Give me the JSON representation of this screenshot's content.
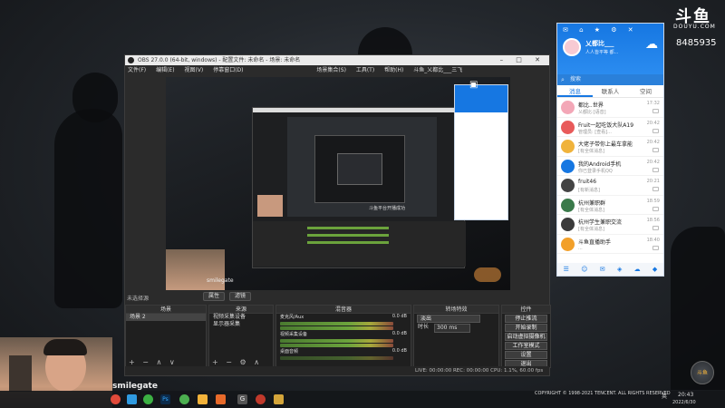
{
  "brand": {
    "logo_text": "斗鱼",
    "logo_sub": "DOUYU.COM",
    "room_id": "8485935"
  },
  "obs": {
    "title": "OBS 27.0.0 (64-bit, windows) - 配置文件: 未命名 - 场景: 未命名",
    "menu": [
      "文件(F)",
      "编辑(E)",
      "视图(V)",
      "停靠窗口(D)",
      "场景集合(S)",
      "工具(T)",
      "帮助(H)",
      "斗鱼_乂都比___三飞"
    ],
    "scene_label": "未选择源",
    "props_btn": "属性",
    "filters_btn": "滤镜",
    "docks": {
      "scenes": {
        "title": "场景",
        "items": [
          "场景 2"
        ]
      },
      "sources": {
        "title": "来源",
        "items": [
          "视频采集设备",
          "显示器采集"
        ]
      },
      "mixer": {
        "title": "混音器",
        "ch1": "麦克风/Aux",
        "ch2": "视频采集设备",
        "ch3": "桌面音频",
        "db1": "0.0 dB",
        "db2": "0.0 dB",
        "db3": "0.0 dB"
      },
      "transitions": {
        "title": "转场特效",
        "type": "淡出",
        "duration_label": "时长",
        "duration": "300 ms"
      },
      "controls": {
        "title": "控件",
        "buttons": [
          "停止推流",
          "开始录制",
          "启动虚拟摄像机",
          "工作室模式",
          "设置",
          "退出"
        ]
      }
    },
    "status": "LIVE: 00:00:00   REC: 00:00:00   CPU: 1.1%, 60.00 fps"
  },
  "preview": {
    "watermark": "smilegate",
    "nested_caption": "斗鱼平台开播成功"
  },
  "qq": {
    "username": "乂都比___",
    "signature": "人人皆平等 都...",
    "search_placeholder": "搜索",
    "tabs": [
      "消息",
      "联系人",
      "空间"
    ],
    "conversations": [
      {
        "name": "都比..世界",
        "msg": "乂都比:[语音]",
        "time": "17:32",
        "color": "#f3a7b7"
      },
      {
        "name": "Fruit一起吃饭大队A19",
        "msg": "管理员: [查看]...",
        "time": "20:42",
        "color": "#e85a5a"
      },
      {
        "name": "大佬子带你上最车拿能",
        "msg": "[有全体消息]",
        "time": "20:42",
        "color": "#f0b33c"
      },
      {
        "name": "我的Android手机",
        "msg": "你已登录手机QQ",
        "time": "20:42",
        "color": "#1677e2"
      },
      {
        "name": "fruit46",
        "msg": "[有新消息]",
        "time": "20:21",
        "color": "#444"
      },
      {
        "name": "杭州兼职群",
        "msg": "[有全体消息]",
        "time": "18:59",
        "color": "#3a7a4a"
      },
      {
        "name": "杭州学生兼职交流",
        "msg": "[有全体消息]",
        "time": "18:56",
        "color": "#3a3a3a"
      },
      {
        "name": "斗鱼直播助手",
        "msg": "...",
        "time": "18:40",
        "color": "#f2a02a"
      }
    ]
  },
  "taskbar": {
    "copyright": "COPYRIGHT © 1998-2021 TENCENT. ALL RIGHTS RESERVED",
    "time": "20:43",
    "date": "2022/6/30",
    "ime": "英"
  },
  "corner_badge": "斗鱼"
}
